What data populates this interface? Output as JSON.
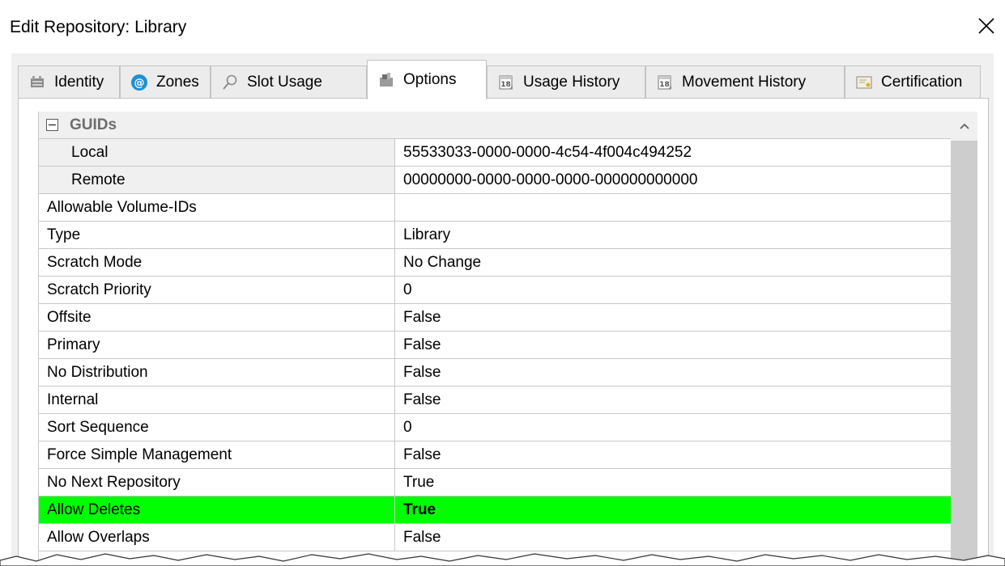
{
  "window": {
    "title": "Edit Repository: Library"
  },
  "tabs": [
    {
      "label": "Identity",
      "icon": "identity-icon"
    },
    {
      "label": "Zones",
      "icon": "at-sign-icon"
    },
    {
      "label": "Slot Usage",
      "icon": "magnifier-icon"
    },
    {
      "label": "Options",
      "icon": "options-icon",
      "active": true
    },
    {
      "label": "Usage History",
      "icon": "calendar-icon"
    },
    {
      "label": "Movement History",
      "icon": "calendar-icon"
    },
    {
      "label": "Certification",
      "icon": "certificate-icon"
    }
  ],
  "grid": {
    "category": {
      "label": "GUIDs"
    },
    "guids": [
      {
        "name": "Local",
        "value": "55533033-0000-0000-4c54-4f004c494252"
      },
      {
        "name": "Remote",
        "value": "00000000-0000-0000-0000-000000000000"
      }
    ],
    "rows": [
      {
        "name": "Allowable Volume-IDs",
        "value": ""
      },
      {
        "name": "Type",
        "value": "Library"
      },
      {
        "name": "Scratch Mode",
        "value": "No Change"
      },
      {
        "name": "Scratch Priority",
        "value": "0"
      },
      {
        "name": "Offsite",
        "value": "False"
      },
      {
        "name": "Primary",
        "value": "False"
      },
      {
        "name": "No Distribution",
        "value": "False"
      },
      {
        "name": "Internal",
        "value": "False"
      },
      {
        "name": "Sort Sequence",
        "value": "0"
      },
      {
        "name": "Force Simple Management",
        "value": "False"
      },
      {
        "name": "No Next Repository",
        "value": "True"
      },
      {
        "name": "Allow Deletes",
        "value": "True",
        "highlighted": true
      },
      {
        "name": "Allow Overlaps",
        "value": "False"
      }
    ]
  },
  "colors": {
    "highlight": "#00ff00",
    "category_text": "#6d6d6d",
    "zones_icon": "#1e90d6"
  }
}
